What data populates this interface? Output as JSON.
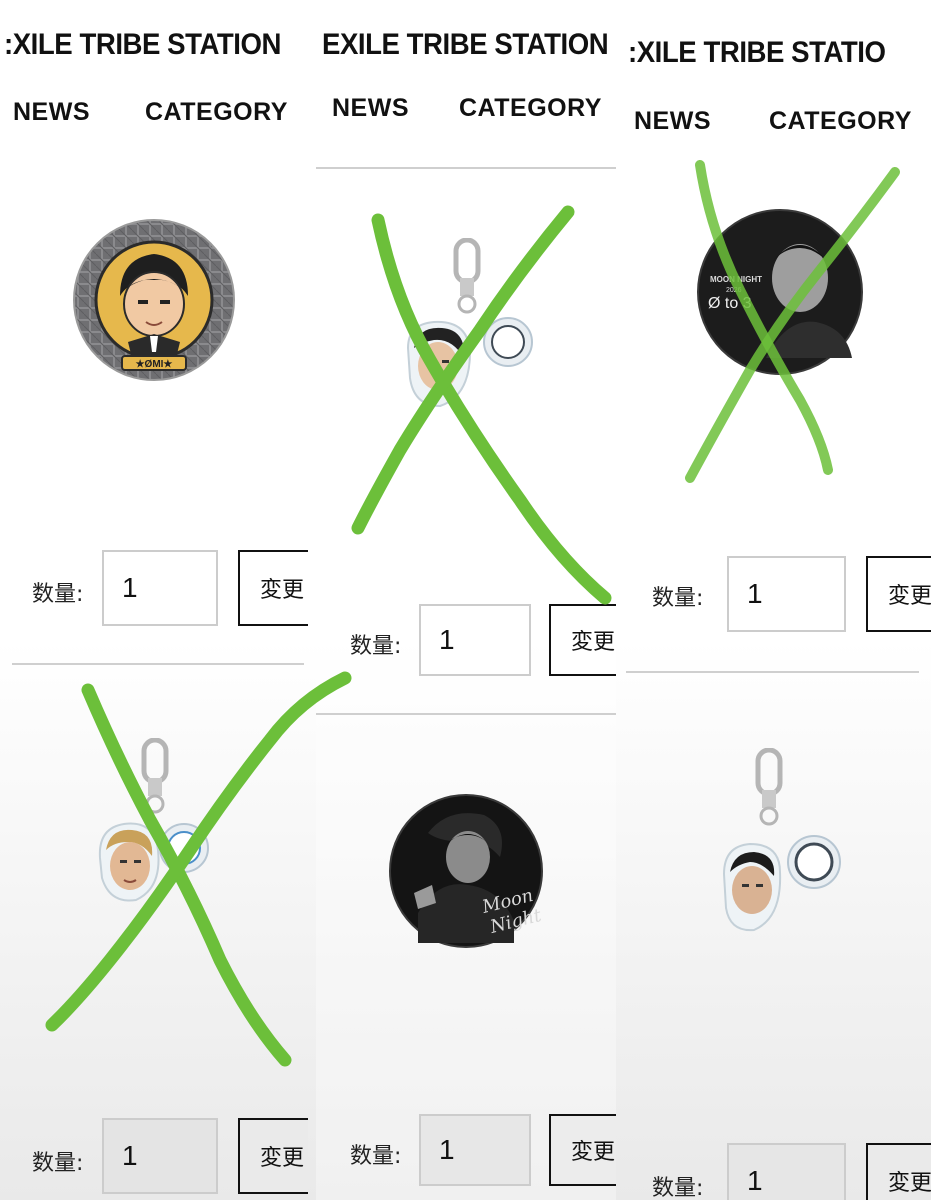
{
  "site": {
    "brand_bold": "EXILE TRIBE",
    "brand_thin": "STATION",
    "panel1_brand": ":XILE TRIBE STATION",
    "panel2_brand": "EXILE TRIBE STATION",
    "panel3_brand": ":XILE TRIBE STATIO"
  },
  "nav": {
    "news": "NEWS",
    "category": "CATEGORY"
  },
  "quantity": {
    "label": "数量:",
    "value": "1"
  },
  "button": {
    "change": "変更",
    "change_cut": "変"
  },
  "badge_text": {
    "omi_ring": "ØMI MOON NIGHT 2026 \"Ø to 3\"",
    "omi_name": "★ØMI★",
    "moon_night": "MOON NIGHT 2026",
    "zero_to_three": "Ø to 3",
    "moon_script": "Moon Night"
  },
  "colors": {
    "strike": "#6cbf3a",
    "text": "#111111",
    "border": "#cccccc"
  }
}
